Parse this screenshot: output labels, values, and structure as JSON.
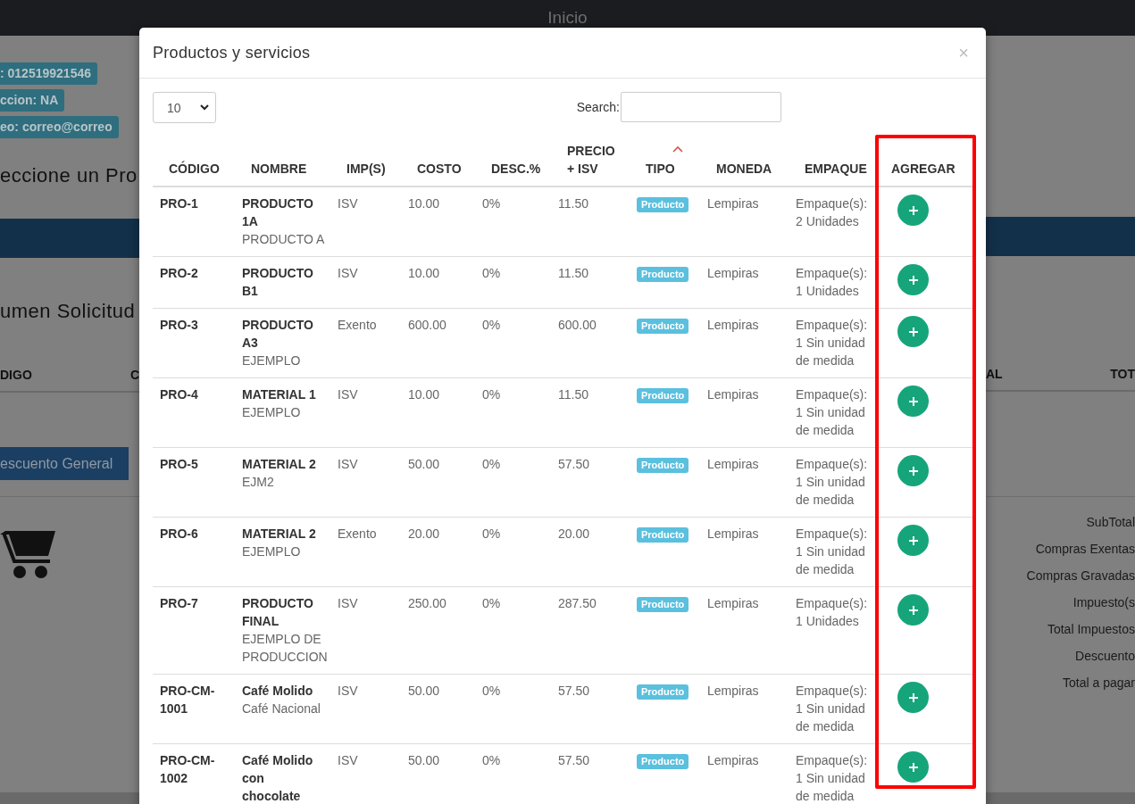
{
  "top_bar": {
    "title": "Inicio"
  },
  "background_page": {
    "left": {
      "badges": [
        ": 012519921546",
        "ccion: NA",
        "eo: correo@correo"
      ],
      "heading": "eccione un Pro",
      "section_heading": "umen Solicitud",
      "table_headers": [
        "DIGO",
        "C"
      ],
      "button": "escuento General"
    },
    "right": {
      "table_headers": [
        "AL",
        "TOT"
      ],
      "summary_labels": [
        "SubTotal",
        "Compras Exentas",
        "Compras Gravadas",
        "Impuesto(s",
        "Total Impuestos",
        "Descuento",
        "Total a pagar"
      ]
    }
  },
  "modal": {
    "title": "Productos y servicios",
    "close": "×",
    "page_length": "10",
    "search_label": "Search:",
    "columns": [
      {
        "label": "CÓDIGO"
      },
      {
        "label": "NOMBRE"
      },
      {
        "label": "IMP(S)"
      },
      {
        "label": "COSTO"
      },
      {
        "label": "DESC.%"
      },
      {
        "label": "PRECIO + ISV"
      },
      {
        "label": "TIPO",
        "sorted_ascending": true
      },
      {
        "label": "MONEDA"
      },
      {
        "label": "EMPAQUE"
      },
      {
        "label": "AGREGAR",
        "highlighted": true
      }
    ],
    "rows": [
      {
        "code": "PRO-1",
        "name": "PRODUCTO 1A",
        "description": "PRODUCTO A",
        "tax": "ISV",
        "cost": "10.00",
        "discount": "0%",
        "price": "11.50",
        "type": "Producto",
        "currency": "Lempiras",
        "packaging": "Empaque(s): 2 Unidades"
      },
      {
        "code": "PRO-2",
        "name": "PRODUCTO B1",
        "tax": "ISV",
        "cost": "10.00",
        "discount": "0%",
        "price": "11.50",
        "type": "Producto",
        "currency": "Lempiras",
        "packaging": "Empaque(s): 1 Unidades"
      },
      {
        "code": "PRO-3",
        "name": "PRODUCTO A3",
        "description": "EJEMPLO",
        "tax": "Exento",
        "cost": "600.00",
        "discount": "0%",
        "price": "600.00",
        "type": "Producto",
        "currency": "Lempiras",
        "packaging": "Empaque(s): 1 Sin unidad de medida"
      },
      {
        "code": "PRO-4",
        "name": "MATERIAL 1",
        "description": "EJEMPLO",
        "tax": "ISV",
        "cost": "10.00",
        "discount": "0%",
        "price": "11.50",
        "type": "Producto",
        "currency": "Lempiras",
        "packaging": "Empaque(s): 1 Sin unidad de medida"
      },
      {
        "code": "PRO-5",
        "name": "MATERIAL 2",
        "description": "EJM2",
        "tax": "ISV",
        "cost": "50.00",
        "discount": "0%",
        "price": "57.50",
        "type": "Producto",
        "currency": "Lempiras",
        "packaging": "Empaque(s): 1 Sin unidad de medida"
      },
      {
        "code": "PRO-6",
        "name": "MATERIAL 2",
        "description": "EJEMPLO",
        "tax": "Exento",
        "cost": "20.00",
        "discount": "0%",
        "price": "20.00",
        "type": "Producto",
        "currency": "Lempiras",
        "packaging": "Empaque(s): 1 Sin unidad de medida"
      },
      {
        "code": "PRO-7",
        "name": "PRODUCTO FINAL",
        "description": "EJEMPLO DE PRODUCCION",
        "tax": "ISV",
        "cost": "250.00",
        "discount": "0%",
        "price": "287.50",
        "type": "Producto",
        "currency": "Lempiras",
        "packaging": "Empaque(s): 1 Unidades"
      },
      {
        "code": "PRO-CM-1001",
        "name": "Café Molido",
        "description": "Café Nacional",
        "tax": "ISV",
        "cost": "50.00",
        "discount": "0%",
        "price": "57.50",
        "type": "Producto",
        "currency": "Lempiras",
        "packaging": "Empaque(s): 1 Sin unidad de medida"
      },
      {
        "code": "PRO-CM-1002",
        "name": "Café Molido con chocolate",
        "tax": "ISV",
        "cost": "50.00",
        "discount": "0%",
        "price": "57.50",
        "type": "Producto",
        "currency": "Lempiras",
        "packaging": "Empaque(s): 1 Sin unidad de medida"
      }
    ]
  }
}
